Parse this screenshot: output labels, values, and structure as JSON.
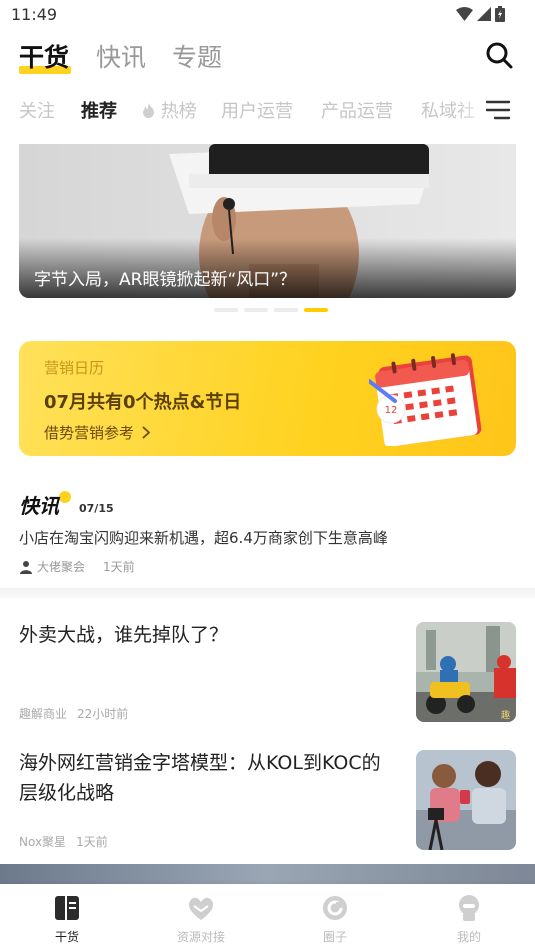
{
  "status_bar": {
    "time": "11:49"
  },
  "header": {
    "tabs": [
      {
        "label": "干货",
        "active": true
      },
      {
        "label": "快讯",
        "active": false
      },
      {
        "label": "专题",
        "active": false
      }
    ],
    "search_icon": "search-icon"
  },
  "sub_tabs": [
    {
      "label": "关注",
      "active": false
    },
    {
      "label": "推荐",
      "active": true
    },
    {
      "label": "热榜",
      "active": false,
      "icon": "flame-icon"
    },
    {
      "label": "用户运营",
      "active": false
    },
    {
      "label": "产品运营",
      "active": false
    },
    {
      "label": "私域社",
      "active": false
    }
  ],
  "banner": {
    "caption": "字节入局，AR眼镜掀起新“风口”？",
    "slide_count": 4,
    "active_slide": 4
  },
  "calendar_card": {
    "label": "营销日历",
    "title": "07月共有0个热点&节日",
    "link": "借势营销参考",
    "illustration_day": "12"
  },
  "flash_news": {
    "logo": "快讯",
    "date": "07/15",
    "text": "小店在淘宝闪购迎来新机遇，超6.4万商家创下生意高峰",
    "source": "大佬聚会",
    "time": "1天前"
  },
  "articles": [
    {
      "title": "外卖大战，谁先掉队了？",
      "source": "趣解商业",
      "time": "22小时前",
      "thumb_watermark": "趣"
    },
    {
      "title": "海外网红营销金字塔模型：从KOL到KOC的层级化战略",
      "source": "Nox聚星",
      "time": "1天前"
    }
  ],
  "bottom_nav": [
    {
      "label": "干货",
      "icon": "book-icon",
      "active": true
    },
    {
      "label": "资源对接",
      "icon": "handshake-heart-icon",
      "active": false
    },
    {
      "label": "圈子",
      "icon": "circle-icon",
      "active": false
    },
    {
      "label": "我的",
      "icon": "profile-icon",
      "active": false
    }
  ],
  "colors": {
    "accent": "#ffd21f",
    "text_primary": "#222222",
    "text_muted": "#999999"
  }
}
